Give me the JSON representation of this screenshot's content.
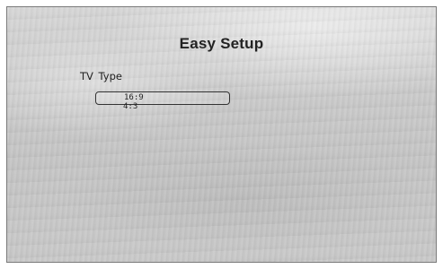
{
  "screen": {
    "title": "Easy Setup"
  },
  "setting": {
    "label": "TV  Type",
    "options": [
      {
        "label": "16:9",
        "selected": true
      },
      {
        "label": "4:3",
        "selected": false
      }
    ]
  }
}
